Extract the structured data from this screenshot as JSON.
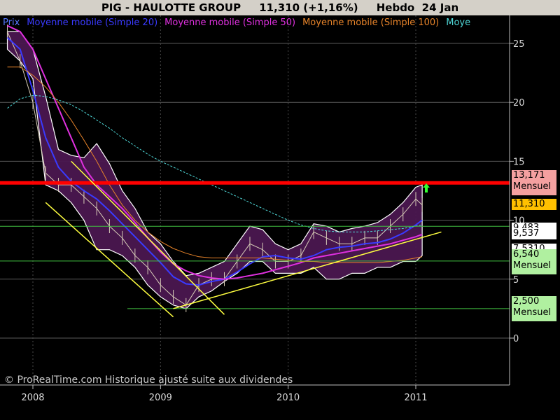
{
  "header": {
    "title": "PIG - HAULOTTE GROUP     11,310 (+1,16%)     Hebdo  24 Jan"
  },
  "legend": [
    {
      "label": "Prix",
      "color": "#5577ff"
    },
    {
      "label": "Moyenne mobile (Simple 20)",
      "color": "#3a3aff"
    },
    {
      "label": "Moyenne mobile (Simple 50)",
      "color": "#e030e0"
    },
    {
      "label": "Moyenne mobile (Simple 100)",
      "color": "#e8842a"
    },
    {
      "label": "Moye",
      "color": "#4fd8d8"
    }
  ],
  "credit": "© ProRealTime.com Historique ajusté suite aux dividendes",
  "price_tags": [
    {
      "value": "13,171",
      "sub": "Mensuel",
      "bg": "#f4a0a0"
    },
    {
      "value": "11,310",
      "sub": "",
      "bg": "#ffc000"
    },
    {
      "value": "9,483",
      "sub": "",
      "bg": "#ffffff"
    },
    {
      "value": "9,537",
      "sub": "",
      "bg": "#ffffff"
    },
    {
      "value": "7,5310",
      "sub": "",
      "bg": "#ffffff"
    },
    {
      "value": "6,540",
      "sub": "Mensuel",
      "bg": "#b0f0a0"
    },
    {
      "value": "2,500",
      "sub": "Mensuel",
      "bg": "#b0f0a0"
    }
  ],
  "chart_data": {
    "type": "line",
    "title": "PIG - HAULOTTE GROUP",
    "y_ticks": [
      0,
      5,
      10,
      15,
      20,
      25
    ],
    "x_ticks": [
      "2008",
      "2009",
      "2010",
      "2011"
    ],
    "ylim": [
      -2,
      28
    ],
    "grid": true,
    "x": [
      2007.8,
      2007.9,
      2008.0,
      2008.1,
      2008.2,
      2008.3,
      2008.4,
      2008.5,
      2008.6,
      2008.7,
      2008.8,
      2008.9,
      2009.0,
      2009.1,
      2009.2,
      2009.3,
      2009.4,
      2009.5,
      2009.6,
      2009.7,
      2009.8,
      2009.9,
      2010.0,
      2010.1,
      2010.2,
      2010.3,
      2010.4,
      2010.5,
      2010.6,
      2010.7,
      2010.8,
      2010.9,
      2011.0,
      2011.05
    ],
    "series": [
      {
        "name": "Prix",
        "color": "#d8cdb8",
        "values": [
          26.0,
          23.5,
          20.0,
          14.0,
          13.0,
          13.0,
          12.0,
          11.0,
          9.5,
          8.5,
          7.0,
          6.0,
          4.5,
          3.5,
          2.8,
          4.5,
          5.0,
          5.0,
          6.5,
          8.0,
          7.5,
          6.5,
          6.5,
          7.0,
          9.0,
          8.5,
          8.0,
          8.0,
          8.5,
          8.5,
          9.5,
          10.5,
          11.8,
          11.3
        ]
      },
      {
        "name": "Moyenne mobile (Simple 20)",
        "color": "#3a3aff",
        "values": [
          25.5,
          24.5,
          21.0,
          17.0,
          14.5,
          13.3,
          12.5,
          11.8,
          10.8,
          9.7,
          8.6,
          7.5,
          6.4,
          5.2,
          4.6,
          4.5,
          4.8,
          5.0,
          5.6,
          6.3,
          6.9,
          7.0,
          6.8,
          6.7,
          7.0,
          7.5,
          7.7,
          7.8,
          8.0,
          8.1,
          8.4,
          8.9,
          9.6,
          10.0
        ]
      },
      {
        "name": "Moyenne mobile (Simple 50)",
        "color": "#e030e0",
        "values": [
          26.5,
          26.0,
          24.5,
          22.0,
          19.5,
          17.0,
          14.5,
          13.0,
          12.0,
          11.0,
          9.8,
          8.5,
          7.3,
          6.3,
          5.7,
          5.3,
          5.1,
          5.0,
          5.1,
          5.3,
          5.5,
          5.8,
          6.1,
          6.4,
          6.8,
          7.0,
          7.2,
          7.4,
          7.6,
          7.8,
          8.0,
          8.3,
          8.6,
          8.8
        ]
      },
      {
        "name": "Moyenne mobile (Simple 100)",
        "color": "#e8842a",
        "values": [
          23.0,
          23.0,
          22.3,
          21.3,
          20.0,
          18.5,
          16.8,
          15.0,
          13.0,
          11.3,
          10.0,
          9.0,
          8.2,
          7.6,
          7.2,
          6.9,
          6.8,
          6.8,
          6.8,
          6.8,
          6.8,
          6.7,
          6.6,
          6.5,
          6.5,
          6.4,
          6.4,
          6.4,
          6.4,
          6.4,
          6.5,
          6.6,
          6.8,
          6.9
        ]
      },
      {
        "name": "Moye",
        "color": "#4fd8d8",
        "values": [
          19.5,
          20.3,
          20.6,
          20.5,
          20.2,
          19.8,
          19.2,
          18.5,
          17.8,
          17.0,
          16.3,
          15.6,
          15.0,
          14.5,
          14.0,
          13.5,
          13.0,
          12.5,
          12.0,
          11.5,
          11.0,
          10.5,
          10.0,
          9.6,
          9.3,
          9.1,
          9.0,
          9.0,
          9.0,
          9.1,
          9.2,
          9.3,
          9.5,
          9.6
        ]
      }
    ],
    "band": {
      "upper": [
        26.0,
        26.0,
        24.5,
        20.5,
        16.0,
        15.5,
        15.3,
        16.5,
        14.8,
        12.5,
        11.0,
        9.0,
        8.0,
        6.5,
        5.3,
        5.5,
        6.0,
        6.5,
        8.0,
        9.5,
        9.2,
        8.0,
        7.5,
        8.0,
        9.7,
        9.5,
        9.0,
        9.3,
        9.5,
        9.8,
        10.5,
        11.5,
        12.8,
        13.0
      ],
      "lower": [
        24.5,
        23.5,
        22.0,
        13.0,
        12.5,
        11.5,
        10.0,
        7.5,
        7.5,
        7.0,
        6.0,
        4.5,
        3.5,
        2.8,
        2.5,
        3.5,
        4.0,
        4.8,
        5.5,
        6.5,
        6.5,
        5.5,
        5.5,
        5.5,
        6.0,
        5.0,
        5.0,
        5.5,
        5.5,
        6.0,
        6.0,
        6.5,
        6.5,
        7.0
      ]
    },
    "horizontal_lines": [
      {
        "y": 13.171,
        "color": "#ff0000",
        "label": "13,171 Mensuel"
      },
      {
        "y": 9.483,
        "color": "#40c040",
        "label": "9,483"
      },
      {
        "y": 6.54,
        "color": "#40c040",
        "label": "6,540 Mensuel"
      },
      {
        "y": 2.5,
        "color": "#40c040",
        "label": "2,500 Mensuel"
      }
    ],
    "trend_lines": [
      {
        "color": "#ffff40",
        "points": [
          [
            2008.1,
            11.5
          ],
          [
            2009.1,
            1.8
          ]
        ]
      },
      {
        "color": "#ffff40",
        "points": [
          [
            2008.3,
            15.0
          ],
          [
            2009.5,
            2.0
          ]
        ]
      },
      {
        "color": "#ffff40",
        "points": [
          [
            2009.1,
            2.5
          ],
          [
            2011.2,
            9.0
          ]
        ]
      }
    ]
  }
}
